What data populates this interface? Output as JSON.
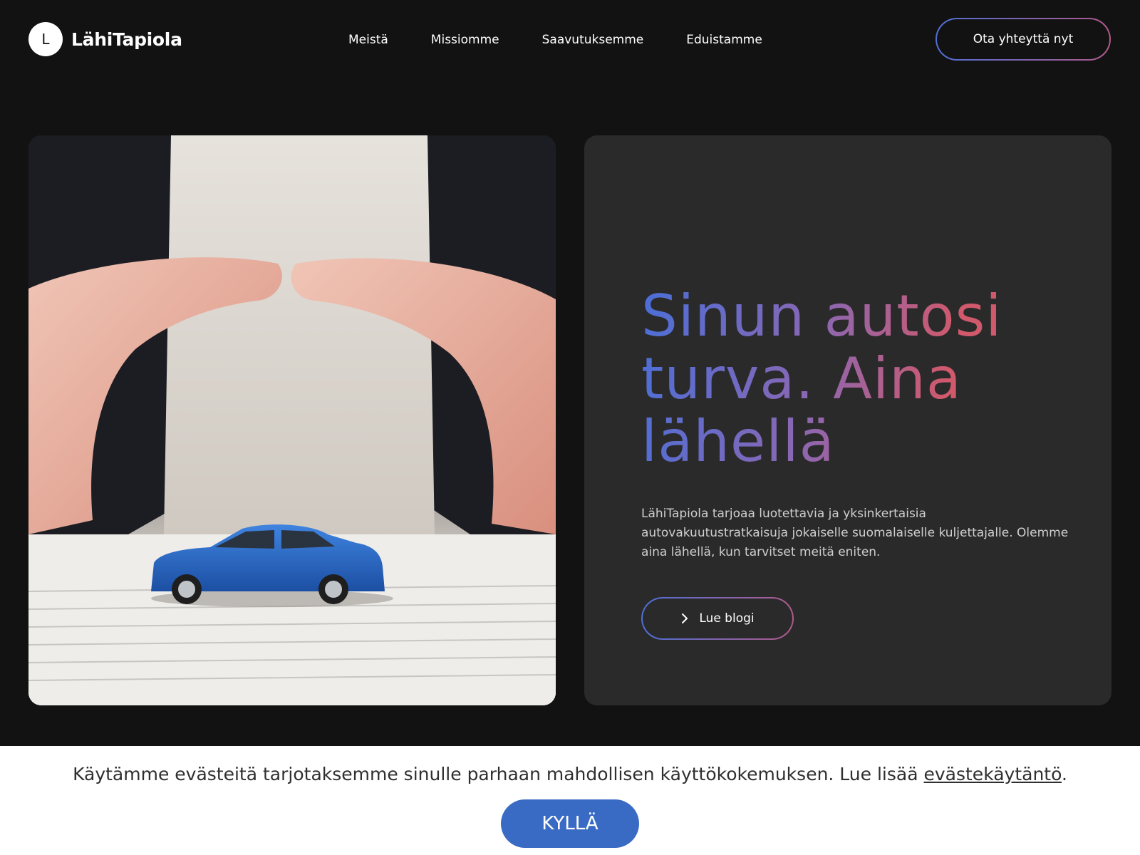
{
  "header": {
    "logo_letter": "L",
    "logo_text": "LähiTapiola",
    "nav": [
      {
        "label": "Meistä"
      },
      {
        "label": "Missiomme"
      },
      {
        "label": "Saavutuksemme"
      },
      {
        "label": "Eduistamme"
      }
    ],
    "contact_label": "Ota yhteyttä nyt"
  },
  "hero": {
    "image_icon": "hands-protecting-toy-car-photo",
    "title": "Sinun autosi turva. Aina lähellä",
    "description": "LähiTapiola tarjoaa luotettavia ja yksinkertaisia autovakuutustratkaisuja jokaiselle suomalaiselle kuljettajalle. Olemme aina lähellä, kun tarvitset meitä eniten.",
    "button_label": "Lue blogi",
    "button_icon": "chevron-right-icon"
  },
  "cookie": {
    "text": "Käytämme evästeitä tarjotaksemme sinulle parhaan mahdollisen käyttökokemuksen. Lue lisää ",
    "link_label": "evästekäytäntö",
    "suffix": ".",
    "accept_label": "KYLLÄ"
  },
  "colors": {
    "background": "#121212",
    "card": "#2a2a2b",
    "gradient_start": "#4a6fd8",
    "gradient_end": "#d0596b",
    "accept_button": "#3a6bc4"
  }
}
